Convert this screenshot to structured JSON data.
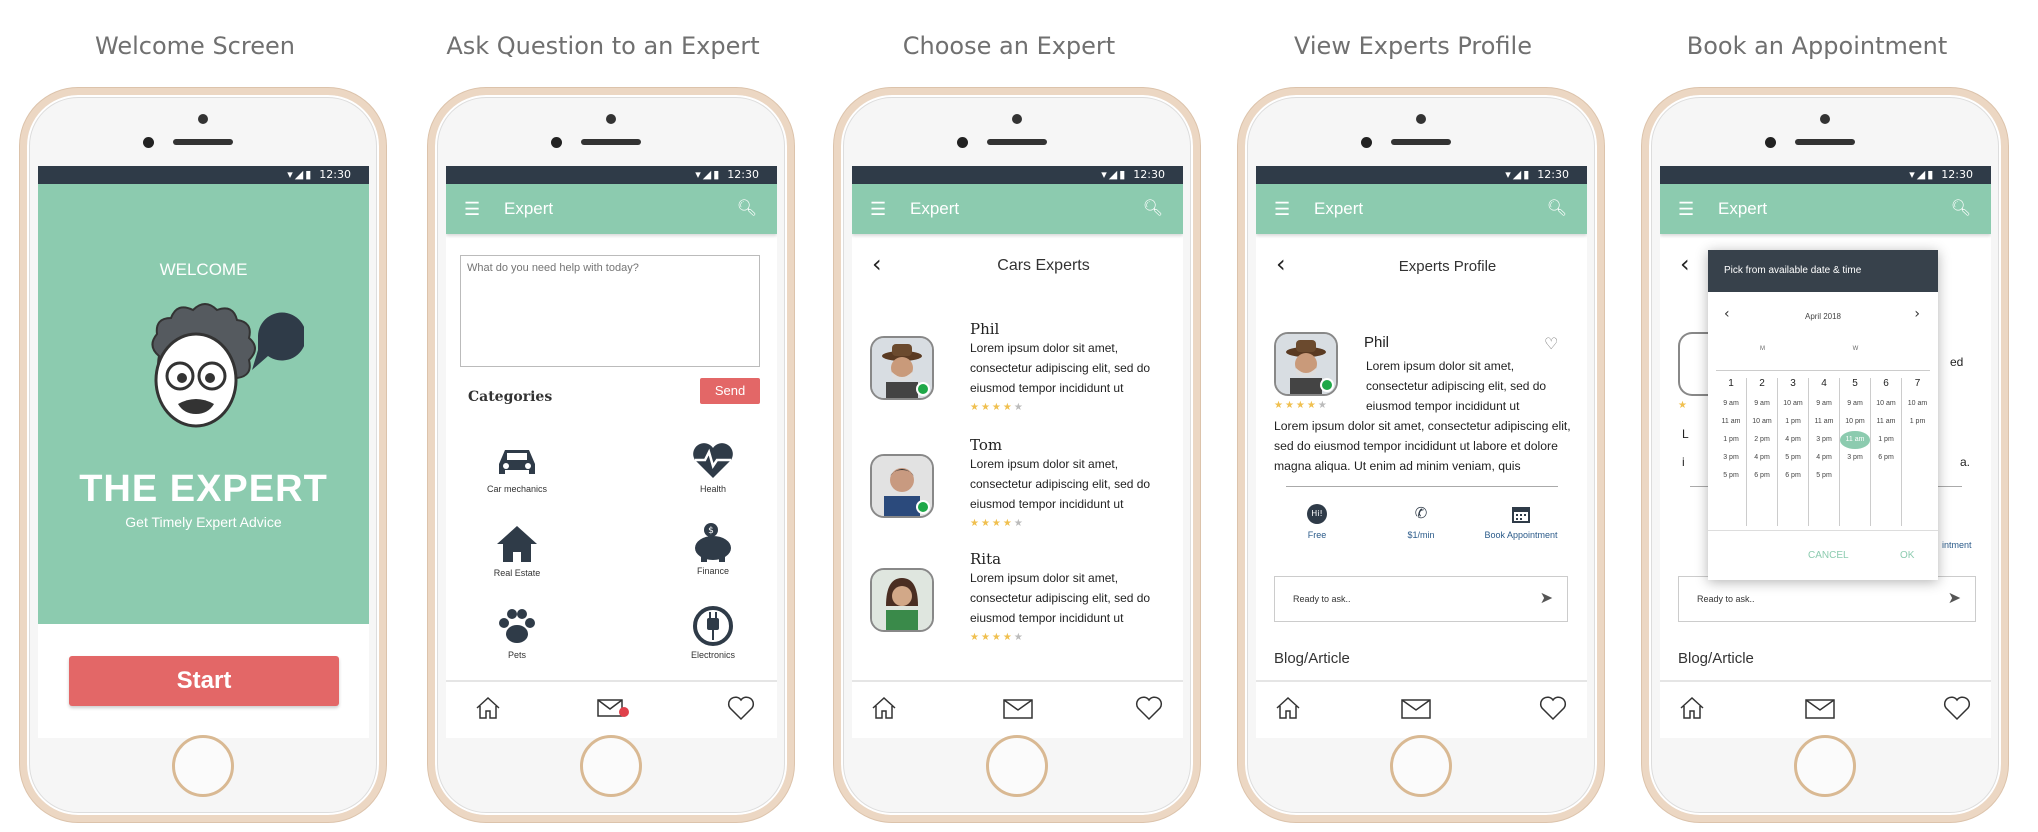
{
  "status_time": "12:30",
  "app_name": "Expert",
  "titles": {
    "s1": "Welcome Screen",
    "s2": "Ask Question to an Expert",
    "s3": "Choose an Expert",
    "s4": "View Experts Profile",
    "s5": "Book an Appointment"
  },
  "welcome": {
    "heading": "WELCOME",
    "brand": "THE EXPERT",
    "tagline": "Get Timely Expert Advice",
    "start_label": "Start"
  },
  "ask": {
    "placeholder": "What do you need help with today?",
    "send_label": "Send",
    "categories_title": "Categories",
    "categories": [
      "Car mechanics",
      "Health",
      "Real Estate",
      "Finance",
      "Pets",
      "Electronics"
    ]
  },
  "choose": {
    "header": "Cars Experts",
    "experts": [
      {
        "name": "Phil",
        "text": "Lorem ipsum dolor sit amet, consectetur adipiscing elit, sed do eiusmod tempor incididunt ut",
        "rating": 4
      },
      {
        "name": "Tom",
        "text": "Lorem ipsum dolor sit amet, consectetur adipiscing elit, sed do eiusmod tempor incididunt ut",
        "rating": 4
      },
      {
        "name": "Rita",
        "text": "Lorem ipsum dolor sit amet, consectetur adipiscing elit, sed do eiusmod tempor incididunt ut",
        "rating": 4
      }
    ]
  },
  "profile": {
    "header": "Experts Profile",
    "name": "Phil",
    "bio_short": "Lorem ipsum dolor sit amet, consectetur adipiscing elit, sed do eiusmod tempor incididunt ut",
    "bio_long": "Lorem ipsum dolor sit amet, consectetur adipiscing elit, sed do eiusmod tempor incididunt ut labore et dolore magna aliqua. Ut enim ad minim veniam, quis",
    "rating": 4,
    "actions": [
      {
        "icon": "hi-bubble-icon",
        "label": "Free"
      },
      {
        "icon": "phone-icon",
        "label": "$1/min"
      },
      {
        "icon": "calendar-icon",
        "label": "Book Appointment"
      }
    ],
    "ask_placeholder": "Ready to ask..",
    "blog_label": "Blog/Article"
  },
  "booking": {
    "dialog_title": "Pick from available date & time",
    "month": "April 2018",
    "weekday_letters": [
      "",
      "M",
      "",
      "",
      "W",
      "",
      ""
    ],
    "days": [
      {
        "day": "1",
        "times": [
          "9 am",
          "11 am",
          "1 pm",
          "3 pm",
          "5 pm"
        ]
      },
      {
        "day": "2",
        "times": [
          "9 am",
          "10 am",
          "2 pm",
          "4 pm",
          "6 pm"
        ]
      },
      {
        "day": "3",
        "times": [
          "10 am",
          "1 pm",
          "4 pm",
          "5 pm",
          "6 pm"
        ]
      },
      {
        "day": "4",
        "times": [
          "9 am",
          "11 am",
          "3 pm",
          "4 pm",
          "5 pm"
        ]
      },
      {
        "day": "5",
        "times": [
          "9 am",
          "10 pm",
          "11 am",
          "3 pm"
        ]
      },
      {
        "day": "6",
        "times": [
          "10 am",
          "11 am",
          "1 pm",
          "6 pm"
        ]
      },
      {
        "day": "7",
        "times": [
          "10 am",
          "1 pm"
        ]
      }
    ],
    "selected": "11 am",
    "cancel_label": "CANCEL",
    "ok_label": "OK",
    "ask_placeholder": "Ready to ask..",
    "blog_label": "Blog/Article",
    "peek_text": [
      "ed",
      "L",
      "i",
      "a."
    ],
    "peek_link": "intment"
  },
  "colors": {
    "accent": "#8ccbaf",
    "dark": "#2f3b48",
    "start_button": "#e36767",
    "stars": "#f0c050",
    "online": "#1fa848"
  }
}
